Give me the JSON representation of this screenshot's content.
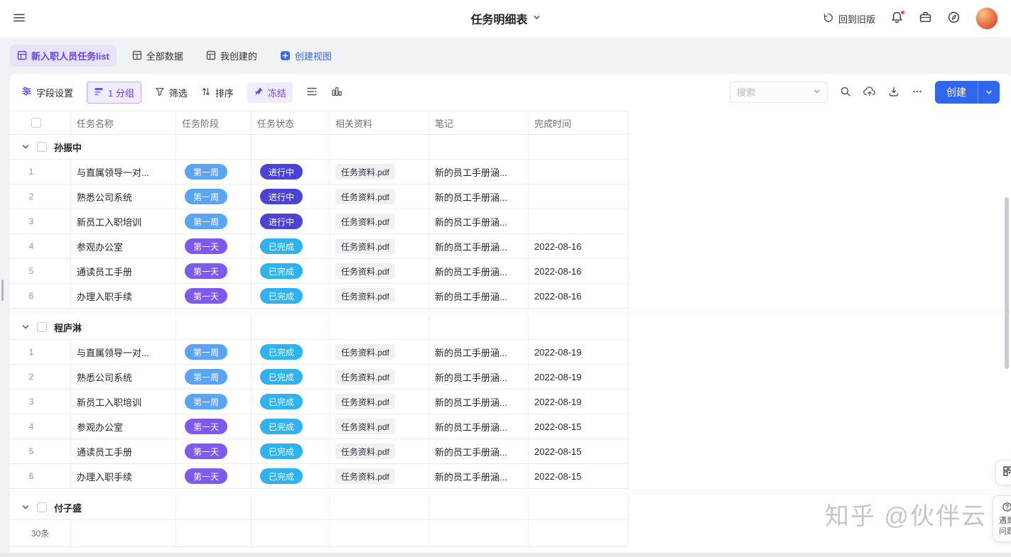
{
  "colors": {
    "accent_purple": "#6442ef",
    "accent_blue": "#3166ee",
    "pills": {
      "第一周": "#59a4f6",
      "第一天": "#7e59f0",
      "进行中": "#4a43d6",
      "已完成": "#2fb3f0"
    }
  },
  "topbar": {
    "title": "任务明细表",
    "back_old_label": "回到旧版"
  },
  "tabs": [
    {
      "label": "新入职人员任务list"
    },
    {
      "label": "全部数据"
    },
    {
      "label": "我创建的"
    },
    {
      "label": "创建视图"
    }
  ],
  "toolbar": {
    "field_settings": "字段设置",
    "group": "1 分组",
    "filter": "筛选",
    "sort": "排序",
    "freeze": "冻结",
    "search_placeholder": "搜索",
    "create": "创建"
  },
  "table": {
    "columns": [
      "任务名称",
      "任务阶段",
      "任务状态",
      "相关资料",
      "笔记",
      "完成时间"
    ],
    "groups": [
      {
        "name": "孙振中",
        "rows": [
          {
            "num": "1",
            "name": "与直属领导一对...",
            "stage": "第一周",
            "status": "进行中",
            "file": "任务资料.pdf",
            "note": "新的员工手册涵...",
            "date": ""
          },
          {
            "num": "2",
            "name": "熟悉公司系统",
            "stage": "第一周",
            "status": "进行中",
            "file": "任务资料.pdf",
            "note": "新的员工手册涵...",
            "date": ""
          },
          {
            "num": "3",
            "name": "新员工入职培训",
            "stage": "第一周",
            "status": "进行中",
            "file": "任务资料.pdf",
            "note": "新的员工手册涵...",
            "date": ""
          },
          {
            "num": "4",
            "name": "参观办公室",
            "stage": "第一天",
            "status": "已完成",
            "file": "任务资料.pdf",
            "note": "新的员工手册涵...",
            "date": "2022-08-16"
          },
          {
            "num": "5",
            "name": "通读员工手册",
            "stage": "第一天",
            "status": "已完成",
            "file": "任务资料.pdf",
            "note": "新的员工手册涵...",
            "date": "2022-08-16"
          },
          {
            "num": "6",
            "name": "办理入职手续",
            "stage": "第一天",
            "status": "已完成",
            "file": "任务资料.pdf",
            "note": "新的员工手册涵...",
            "date": "2022-08-16"
          }
        ]
      },
      {
        "name": "程庐淋",
        "rows": [
          {
            "num": "1",
            "name": "与直属领导一对...",
            "stage": "第一周",
            "status": "已完成",
            "file": "任务资料.pdf",
            "note": "新的员工手册涵...",
            "date": "2022-08-19"
          },
          {
            "num": "2",
            "name": "熟悉公司系统",
            "stage": "第一周",
            "status": "已完成",
            "file": "任务资料.pdf",
            "note": "新的员工手册涵...",
            "date": "2022-08-19"
          },
          {
            "num": "3",
            "name": "新员工入职培训",
            "stage": "第一周",
            "status": "已完成",
            "file": "任务资料.pdf",
            "note": "新的员工手册涵...",
            "date": "2022-08-19"
          },
          {
            "num": "4",
            "name": "参观办公室",
            "stage": "第一天",
            "status": "已完成",
            "file": "任务资料.pdf",
            "note": "新的员工手册涵...",
            "date": "2022-08-15"
          },
          {
            "num": "5",
            "name": "通读员工手册",
            "stage": "第一天",
            "status": "已完成",
            "file": "任务资料.pdf",
            "note": "新的员工手册涵...",
            "date": "2022-08-15"
          },
          {
            "num": "6",
            "name": "办理入职手续",
            "stage": "第一天",
            "status": "已完成",
            "file": "任务资料.pdf",
            "note": "新的员工手册涵...",
            "date": "2022-08-15"
          }
        ]
      },
      {
        "name": "付子盛",
        "rows": []
      }
    ],
    "total_label": "30条"
  },
  "floating": {
    "help_lines": [
      "遇到",
      "问题"
    ]
  },
  "watermark": "知乎 @伙伴云"
}
